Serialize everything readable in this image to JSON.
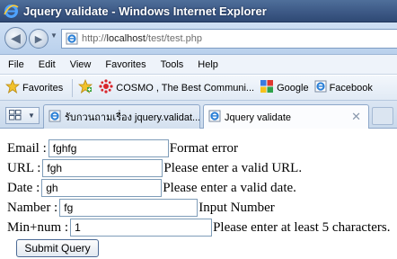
{
  "window": {
    "title": "Jquery validate - Windows Internet Explorer"
  },
  "address_bar": {
    "url_prefix": "http://",
    "url_host": "localhost",
    "url_path": "/test/test.php"
  },
  "menu": {
    "items": [
      "File",
      "Edit",
      "View",
      "Favorites",
      "Tools",
      "Help"
    ]
  },
  "favorites_bar": {
    "favorites_label": "Favorites",
    "items": [
      {
        "label": "COSMO , The Best Communi...",
        "icon": "cosmo-icon"
      },
      {
        "label": "Google",
        "icon": "google-icon"
      },
      {
        "label": "Facebook",
        "icon": "ie-page-icon"
      }
    ]
  },
  "tabs": [
    {
      "label": "รับกวนถามเรื่อง jquery.validat...",
      "active": false
    },
    {
      "label": "Jquery validate",
      "active": true
    }
  ],
  "form": {
    "email": {
      "label": "Email :",
      "value": "fghfg",
      "message": "Format error"
    },
    "url": {
      "label": "URL :",
      "value": "fgh",
      "message": "Please enter a valid URL."
    },
    "date": {
      "label": "Date :",
      "value": "gh",
      "message": "Please enter a valid date."
    },
    "number": {
      "label": "Namber :",
      "value": "fg",
      "message": "Input Number"
    },
    "minnum": {
      "label": "Min+num :",
      "value": "1",
      "message": "Please enter at least 5 characters."
    },
    "submit_label": "Submit Query"
  },
  "colors": {
    "titlebar": "#3b5784",
    "input_border": "#7f9db9",
    "chrome_blue": "#c9d9ec"
  }
}
